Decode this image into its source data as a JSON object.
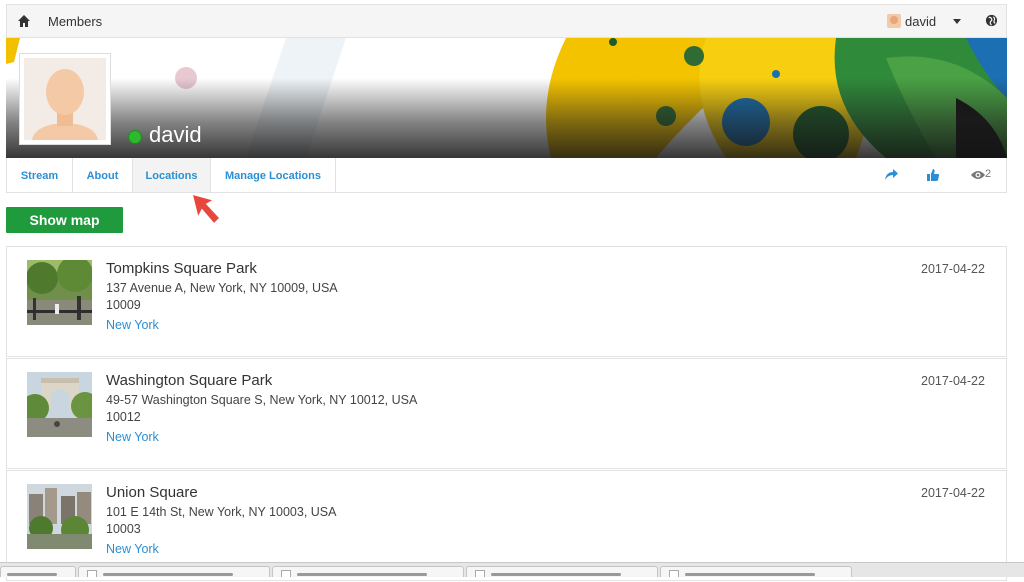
{
  "topbar": {
    "home_icon": "home-icon",
    "members_label": "Members",
    "user_name": "david",
    "caret_icon": "caret-down-icon",
    "globe_icon": "globe-icon"
  },
  "profile": {
    "name": "david",
    "status": "online",
    "status_color": "#2eb82e"
  },
  "tabs": [
    {
      "label": "Stream",
      "active": false
    },
    {
      "label": "About",
      "active": false
    },
    {
      "label": "Locations",
      "active": true
    },
    {
      "label": "Manage Locations",
      "active": false
    }
  ],
  "actions": {
    "share_icon": "share-icon",
    "like_icon": "thumbs-up-icon",
    "views_icon": "eye-icon",
    "view_count": "2"
  },
  "show_map_label": "Show map",
  "locations": [
    {
      "name": "Tompkins Square Park",
      "address": "137 Avenue A, New York, NY 10009, USA",
      "zip": "10009",
      "city": "New York",
      "date": "2017-04-22"
    },
    {
      "name": "Washington Square Park",
      "address": "49-57 Washington Square S, New York, NY 10012, USA",
      "zip": "10012",
      "city": "New York",
      "date": "2017-04-22"
    },
    {
      "name": "Union Square",
      "address": "101 E 14th St, New York, NY 10003, USA",
      "zip": "10003",
      "city": "New York",
      "date": "2017-04-22"
    }
  ],
  "colors": {
    "link": "#2a8fd4",
    "button_green": "#1f9a3c",
    "cursor_red": "#e8473d"
  }
}
